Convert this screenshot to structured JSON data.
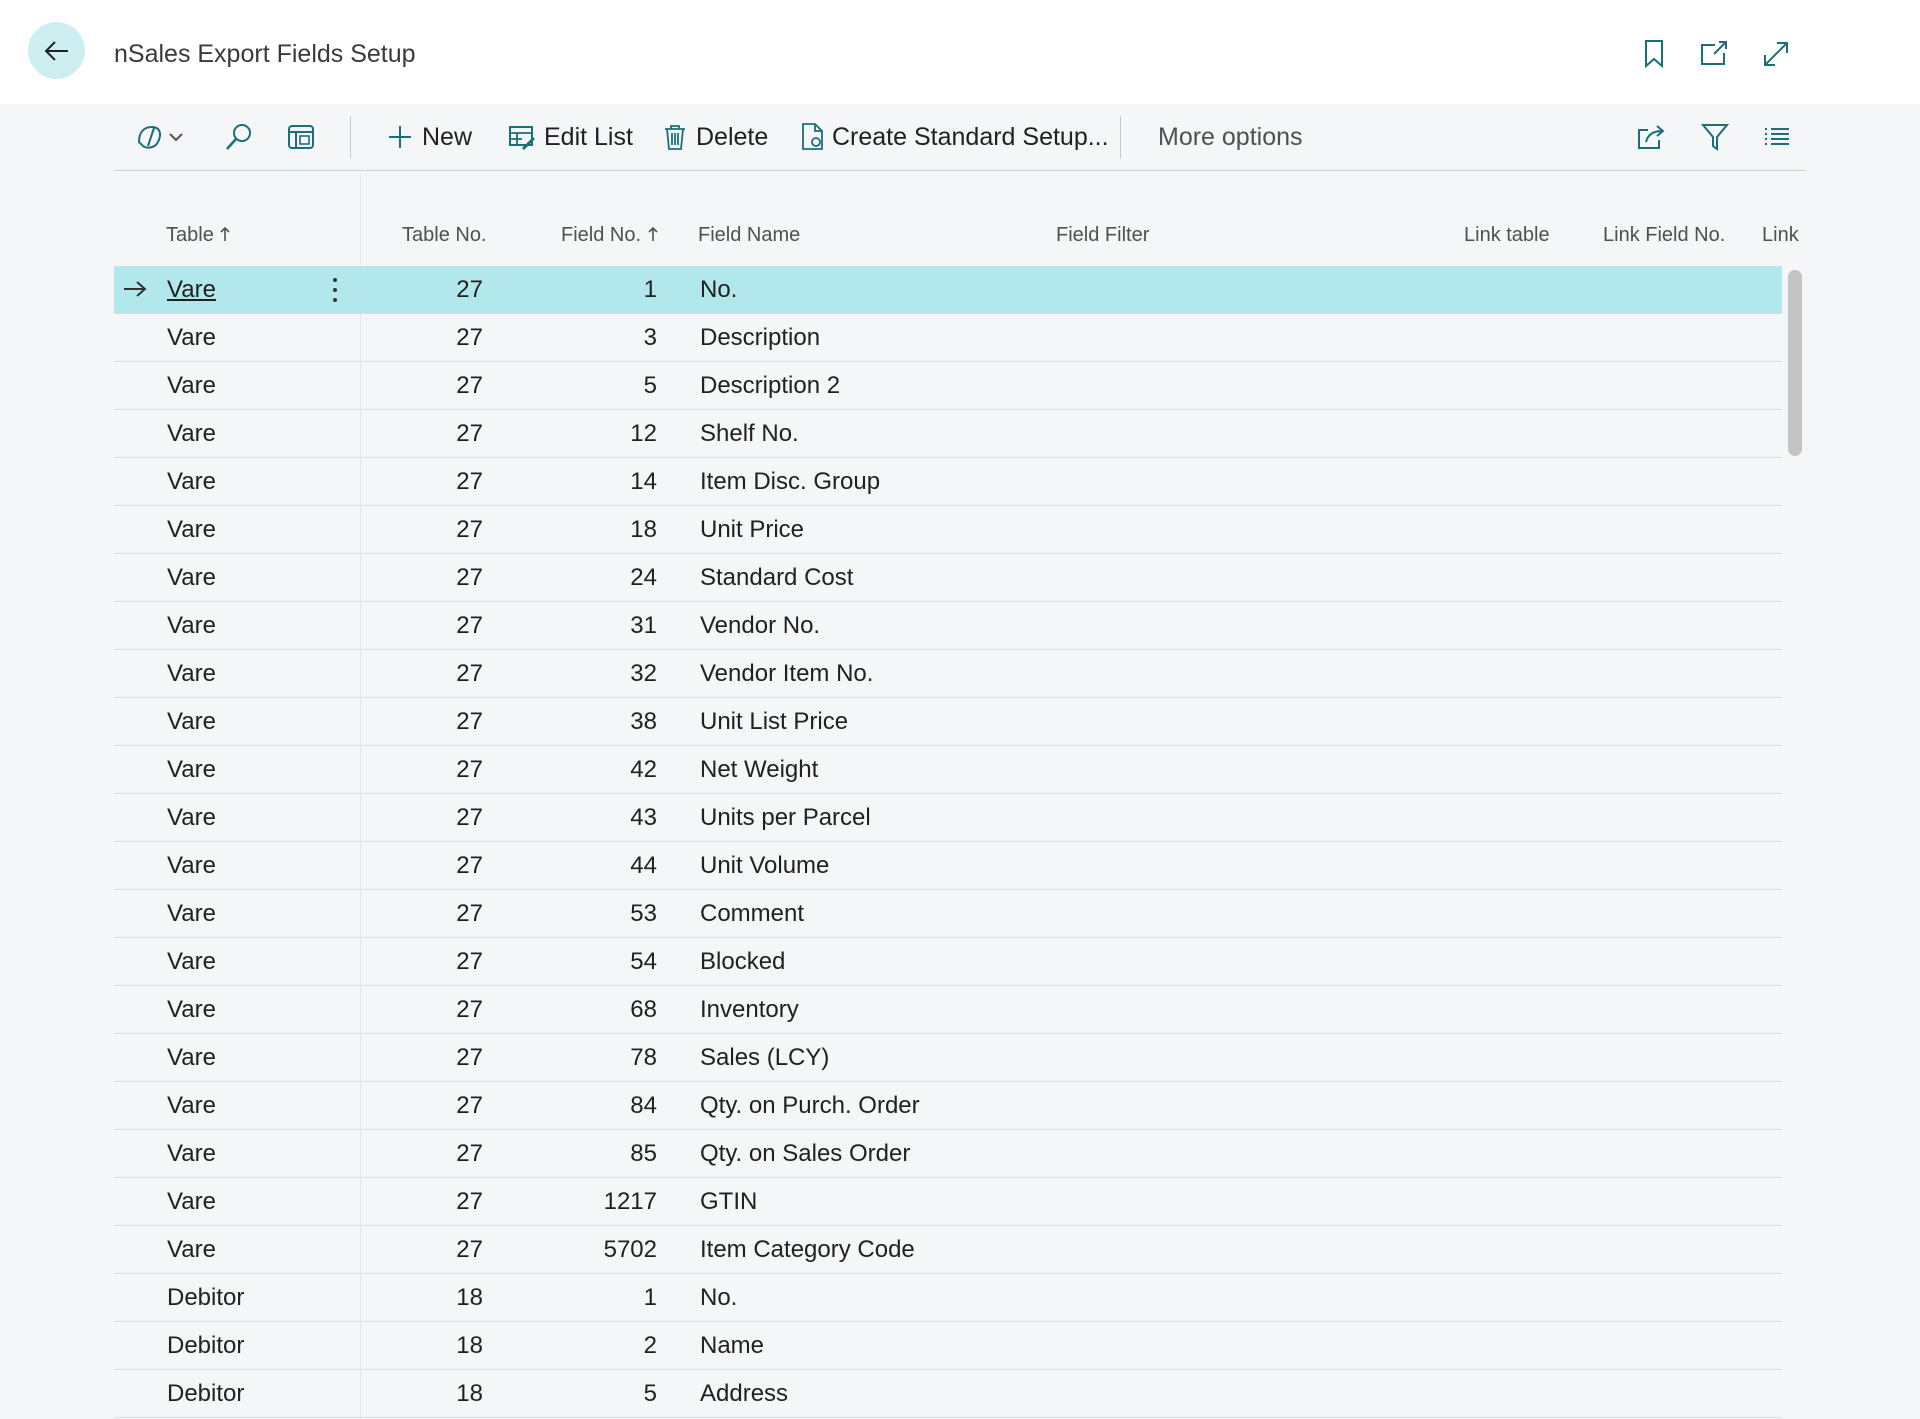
{
  "page": {
    "title": "nSales Export Fields Setup"
  },
  "toolbar": {
    "new_label": "New",
    "edit_list_label": "Edit List",
    "delete_label": "Delete",
    "create_standard_label": "Create Standard Setup...",
    "more_options_label": "More options"
  },
  "columns": {
    "table": "Table",
    "table_no": "Table No.",
    "field_no": "Field No.",
    "field_name": "Field Name",
    "field_filter": "Field Filter",
    "link_table": "Link table",
    "link_field_no": "Link Field No.",
    "link_partial": "Link I"
  },
  "rows": [
    {
      "table": "Vare",
      "table_no": "27",
      "field_no": "1",
      "field_name": "No."
    },
    {
      "table": "Vare",
      "table_no": "27",
      "field_no": "3",
      "field_name": "Description"
    },
    {
      "table": "Vare",
      "table_no": "27",
      "field_no": "5",
      "field_name": "Description 2"
    },
    {
      "table": "Vare",
      "table_no": "27",
      "field_no": "12",
      "field_name": "Shelf No."
    },
    {
      "table": "Vare",
      "table_no": "27",
      "field_no": "14",
      "field_name": "Item Disc. Group"
    },
    {
      "table": "Vare",
      "table_no": "27",
      "field_no": "18",
      "field_name": "Unit Price"
    },
    {
      "table": "Vare",
      "table_no": "27",
      "field_no": "24",
      "field_name": "Standard Cost"
    },
    {
      "table": "Vare",
      "table_no": "27",
      "field_no": "31",
      "field_name": "Vendor No."
    },
    {
      "table": "Vare",
      "table_no": "27",
      "field_no": "32",
      "field_name": "Vendor Item No."
    },
    {
      "table": "Vare",
      "table_no": "27",
      "field_no": "38",
      "field_name": "Unit List Price"
    },
    {
      "table": "Vare",
      "table_no": "27",
      "field_no": "42",
      "field_name": "Net Weight"
    },
    {
      "table": "Vare",
      "table_no": "27",
      "field_no": "43",
      "field_name": "Units per Parcel"
    },
    {
      "table": "Vare",
      "table_no": "27",
      "field_no": "44",
      "field_name": "Unit Volume"
    },
    {
      "table": "Vare",
      "table_no": "27",
      "field_no": "53",
      "field_name": "Comment"
    },
    {
      "table": "Vare",
      "table_no": "27",
      "field_no": "54",
      "field_name": "Blocked"
    },
    {
      "table": "Vare",
      "table_no": "27",
      "field_no": "68",
      "field_name": "Inventory"
    },
    {
      "table": "Vare",
      "table_no": "27",
      "field_no": "78",
      "field_name": "Sales (LCY)"
    },
    {
      "table": "Vare",
      "table_no": "27",
      "field_no": "84",
      "field_name": "Qty. on Purch. Order"
    },
    {
      "table": "Vare",
      "table_no": "27",
      "field_no": "85",
      "field_name": "Qty. on Sales Order"
    },
    {
      "table": "Vare",
      "table_no": "27",
      "field_no": "1217",
      "field_name": "GTIN"
    },
    {
      "table": "Vare",
      "table_no": "27",
      "field_no": "5702",
      "field_name": "Item Category Code"
    },
    {
      "table": "Debitor",
      "table_no": "18",
      "field_no": "1",
      "field_name": "No."
    },
    {
      "table": "Debitor",
      "table_no": "18",
      "field_no": "2",
      "field_name": "Name"
    },
    {
      "table": "Debitor",
      "table_no": "18",
      "field_no": "5",
      "field_name": "Address"
    }
  ],
  "selected_row": 0,
  "icons": {
    "back": "arrow-left-icon",
    "bookmark": "bookmark-icon",
    "open_new_window": "open-new-window-icon",
    "expand": "expand-icon",
    "copilot": "copilot-icon",
    "search": "search-icon",
    "layout": "layout-icon",
    "share": "share-icon",
    "filter": "filter-icon",
    "list_view": "list-view-icon"
  },
  "colors": {
    "accent": "#0e7c86",
    "selected_row": "#b2e8ec",
    "back_button": "#cdeff2"
  }
}
